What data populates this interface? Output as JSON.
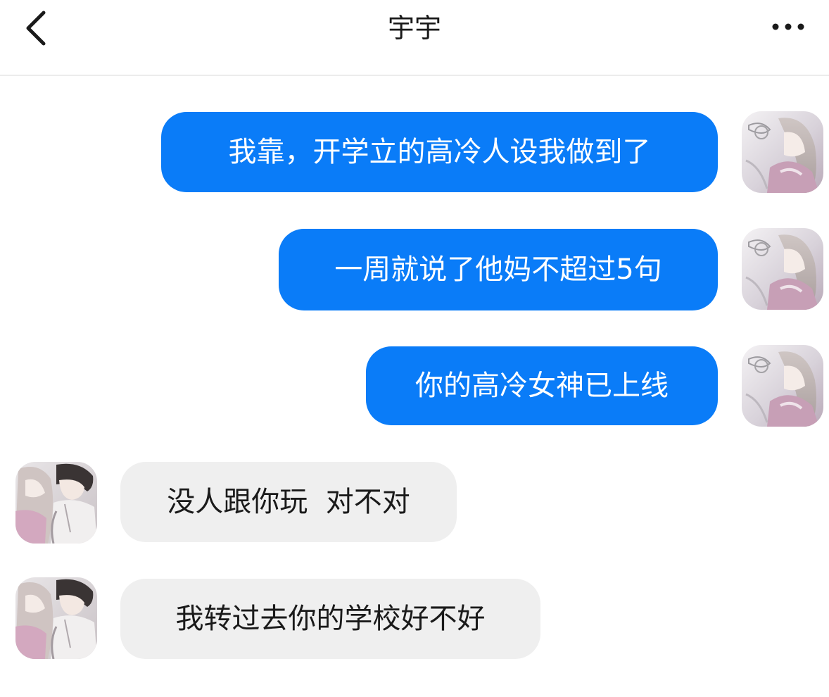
{
  "header": {
    "title": "宇宇",
    "back_icon": "chevron-left-icon",
    "more_icon": "more-horizontal-icon"
  },
  "colors": {
    "outgoing_bubble": "#0a7cf8",
    "incoming_bubble": "#efefef"
  },
  "messages": [
    {
      "direction": "outgoing",
      "text": "我靠，开学立的高冷人设我做到了"
    },
    {
      "direction": "outgoing",
      "text": "一周就说了他妈不超过5句"
    },
    {
      "direction": "outgoing",
      "text": "你的高冷女神已上线"
    },
    {
      "direction": "incoming",
      "text": "没人跟你玩  对不对"
    },
    {
      "direction": "incoming",
      "text": "我转过去你的学校好不好"
    }
  ]
}
